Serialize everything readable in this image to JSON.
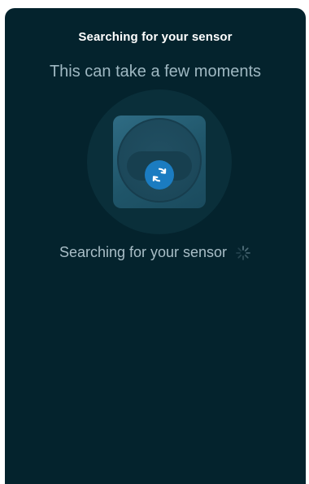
{
  "header": {
    "title": "Searching for your sensor"
  },
  "subtitle": "This can take a few moments",
  "illustration": {
    "center_icon": "sync-icon",
    "badge_color": "#1b7cc1"
  },
  "status": {
    "text": "Searching for your sensor",
    "indicator_icon": "spinner-icon"
  },
  "colors": {
    "background": "#04232d",
    "halo": "#0a2f3a",
    "subtitle_text": "#9fb8c2"
  }
}
